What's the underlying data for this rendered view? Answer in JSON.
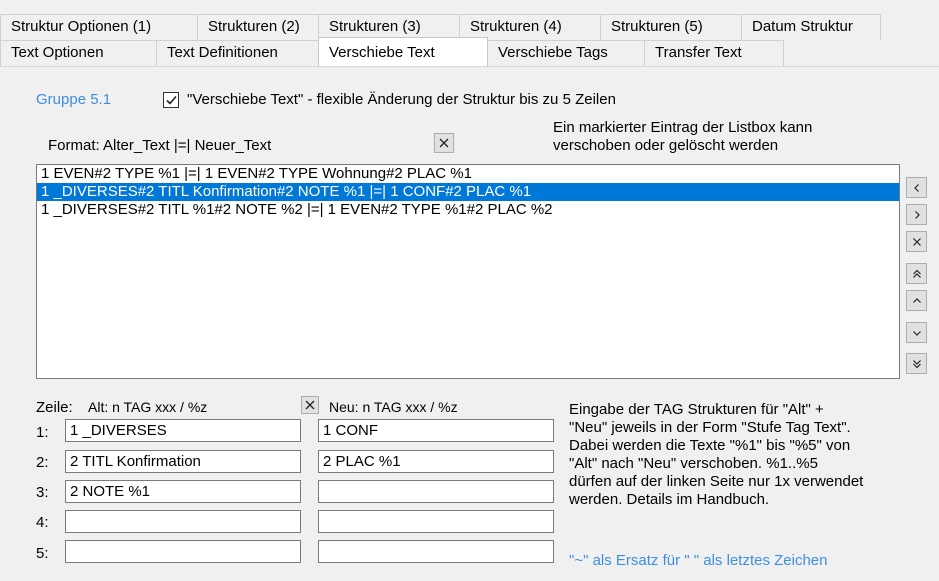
{
  "tabs_row1": [
    "Struktur Optionen (1)",
    "Strukturen (2)",
    "Strukturen (3)",
    "Strukturen (4)",
    "Strukturen (5)",
    "Datum Struktur"
  ],
  "tabs_row2": [
    "Text Optionen",
    "Text Definitionen",
    "Verschiebe Text",
    "Verschiebe Tags",
    "Transfer Text"
  ],
  "active_tab": "Verschiebe Text",
  "group_label": "Gruppe 5.1",
  "checkbox": {
    "checked": true,
    "label": "\"Verschiebe Text\" - flexible Änderung der Struktur bis zu 5 Zeilen"
  },
  "format_label": "Format:  Alter_Text |=| Neuer_Text",
  "list_hint": [
    "Ein markierter Eintrag der Listbox kann",
    "verschoben oder gelöscht werden"
  ],
  "list_items": [
    "1 EVEN#2 TYPE %1 |=| 1 EVEN#2 TYPE Wohnung#2 PLAC %1",
    "1 _DIVERSES#2 TITL Konfirmation#2 NOTE %1 |=| 1 CONF#2 PLAC %1",
    "1 _DIVERSES#2 TITL %1#2 NOTE %2 |=| 1 EVEN#2 TYPE %1#2 PLAC %2"
  ],
  "selected_index": 1,
  "nav_buttons": [
    "left-icon",
    "right-icon",
    "close-icon",
    "double-up-icon",
    "up-icon",
    "down-icon",
    "double-down-icon"
  ],
  "zeile_label": "Zeile:",
  "alt_header": "Alt: n TAG xxx / %z",
  "neu_header": "Neu: n TAG xxx / %z",
  "rows": [
    {
      "label": "1:",
      "alt": "1 _DIVERSES",
      "neu": "1 CONF"
    },
    {
      "label": "2:",
      "alt": "2 TITL Konfirmation",
      "neu": "2 PLAC %1"
    },
    {
      "label": "3:",
      "alt": "2 NOTE %1",
      "neu": ""
    },
    {
      "label": "4:",
      "alt": "",
      "neu": ""
    },
    {
      "label": "5:",
      "alt": "",
      "neu": ""
    }
  ],
  "help_text": [
    "Eingabe der TAG Strukturen für \"Alt\" +",
    "\"Neu\" jeweils in der Form \"Stufe Tag Text\".",
    "Dabei werden die Texte \"%1\" bis \"%5\" von",
    "\"Alt\" nach \"Neu\" verschoben. %1..%5",
    "dürfen auf der linken Seite nur 1x verwendet",
    "werden. Details im Handbuch."
  ],
  "footer_hint": "\"~\" als Ersatz für \" \" als letztes Zeichen",
  "colors": {
    "accent": "#3d8fe0",
    "selection": "#0078d7"
  }
}
